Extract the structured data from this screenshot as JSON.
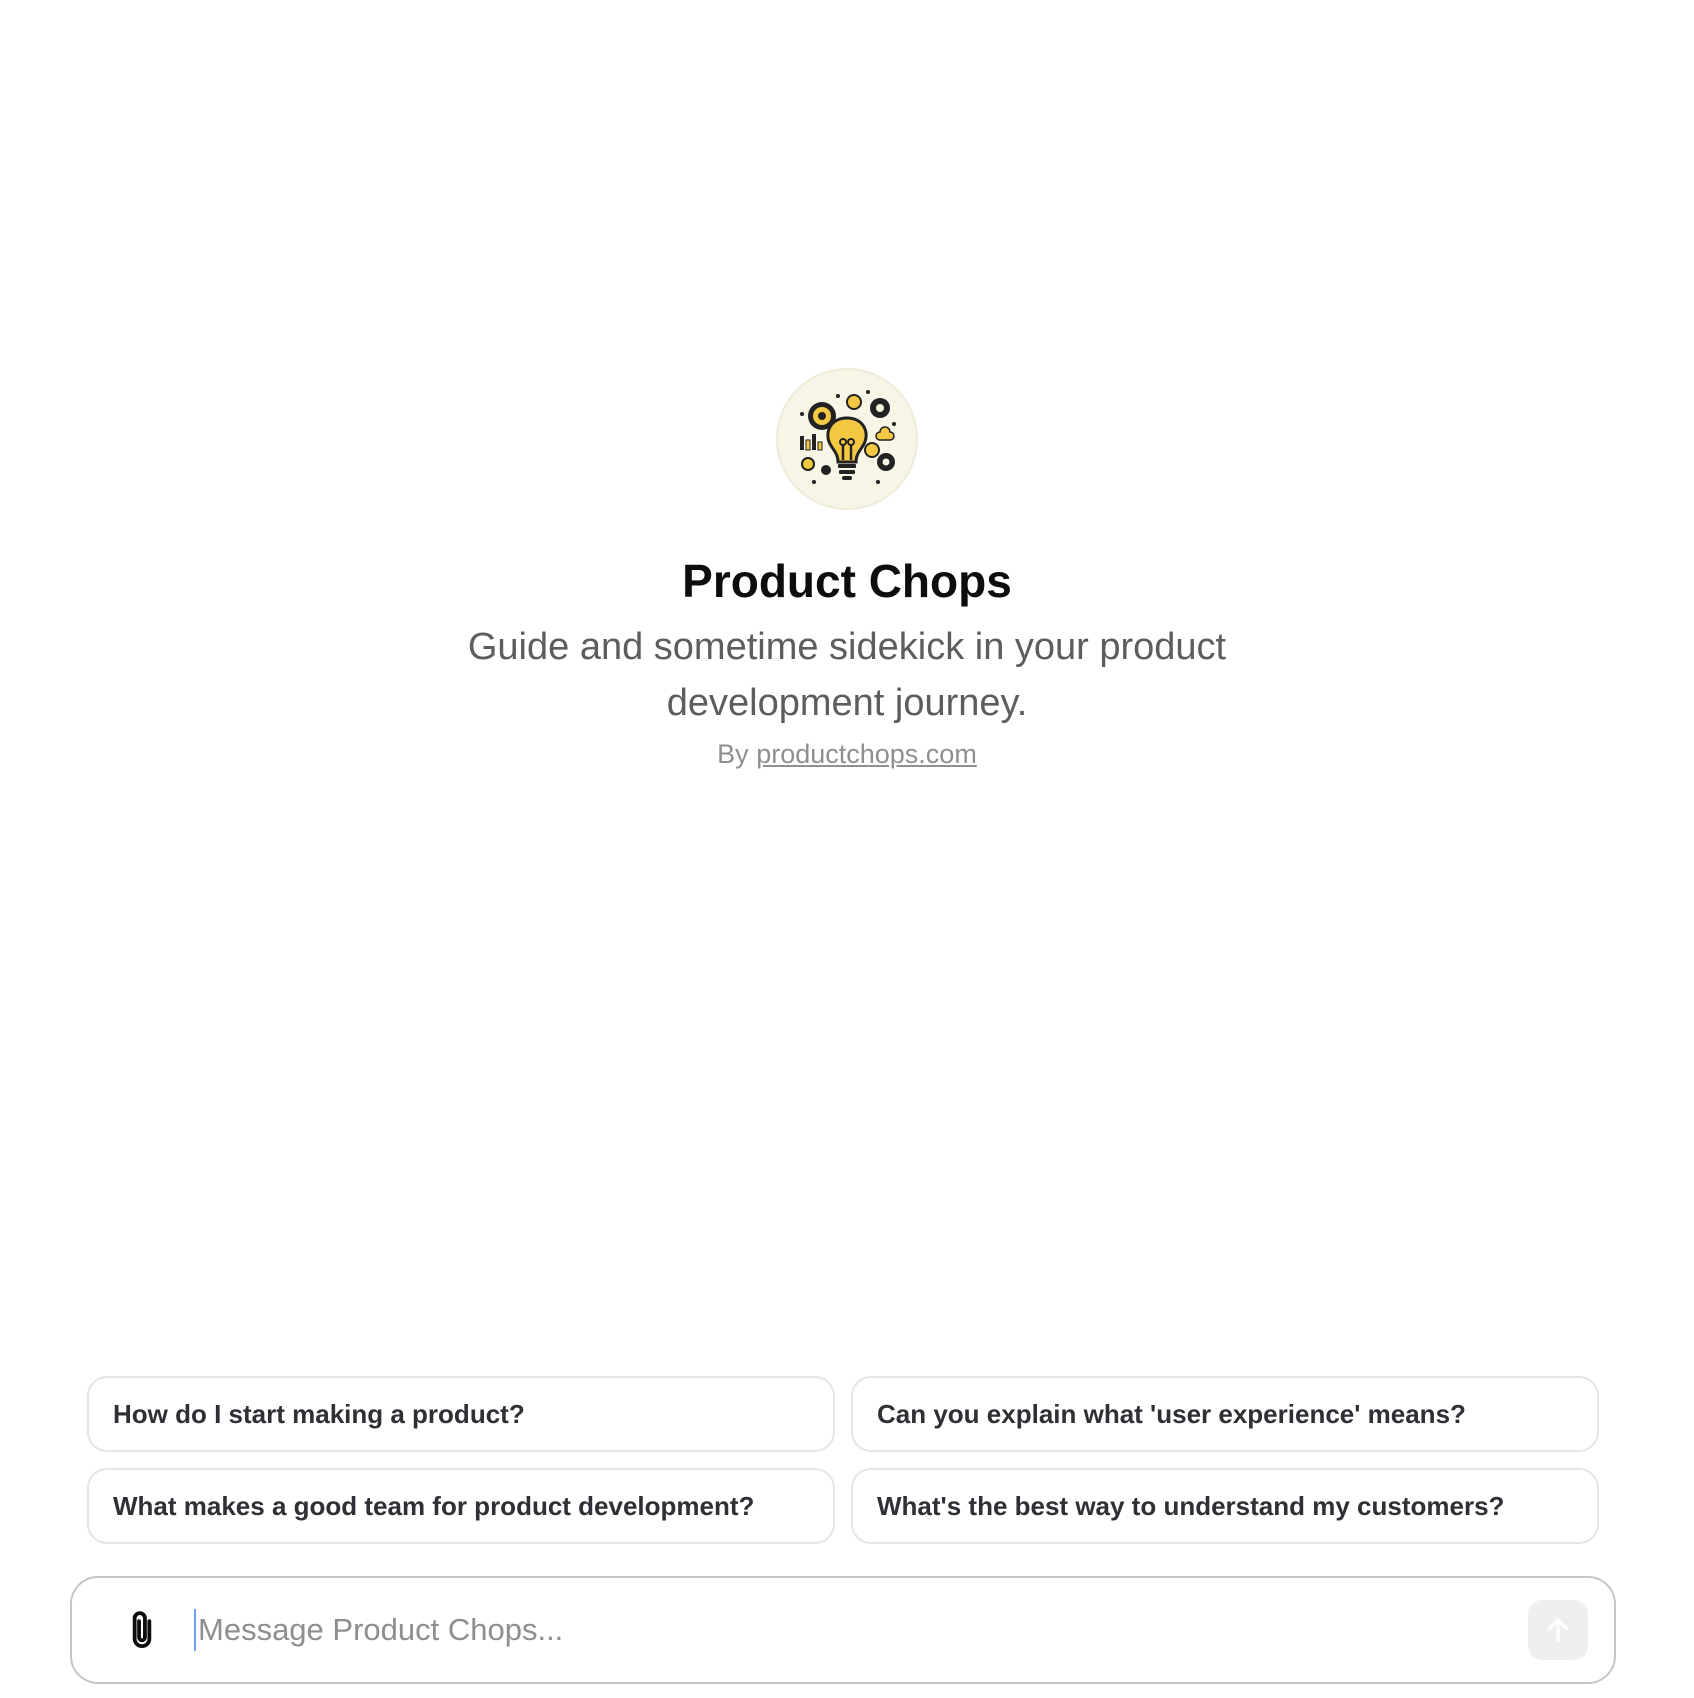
{
  "bot": {
    "avatar_icon": "lightbulb-gears-icon",
    "name": "Product Chops",
    "description": "Guide and sometime sidekick in your product development journey.",
    "by_prefix": "By",
    "by_link": "productchops.com"
  },
  "suggestions": [
    "How do I start making a product?",
    "Can you explain what 'user experience' means?",
    "What makes a good team for product development?",
    "What's the best way to understand my customers?"
  ],
  "composer": {
    "placeholder": "Message Product Chops...",
    "attach_icon": "paperclip-icon",
    "send_icon": "arrow-up-icon"
  },
  "colors": {
    "accent_yellow": "#f4c842",
    "text_secondary": "#5d5d5d",
    "chip_border": "#e5e5e5"
  }
}
